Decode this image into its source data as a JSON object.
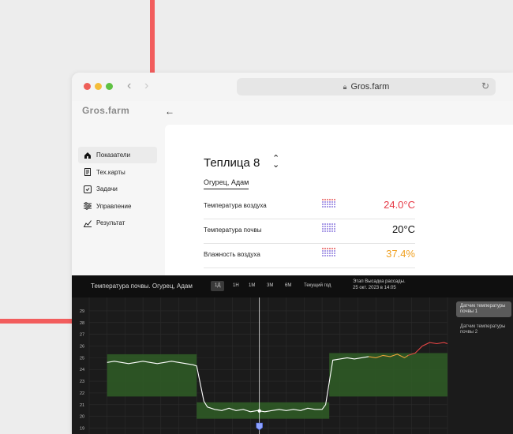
{
  "browser": {
    "url": "Gros.farm"
  },
  "app": {
    "logo": "Gros.farm"
  },
  "sidebar": {
    "items": [
      {
        "label": "Показатели",
        "icon": "home-icon",
        "active": true
      },
      {
        "label": "Тех.карты",
        "icon": "document-icon",
        "active": false
      },
      {
        "label": "Задачи",
        "icon": "task-icon",
        "active": false
      },
      {
        "label": "Управление",
        "icon": "sliders-icon",
        "active": false
      },
      {
        "label": "Результат",
        "icon": "chart-icon",
        "active": false
      }
    ]
  },
  "greenhouse": {
    "title": "Теплица 8",
    "crop": "Огурец, Адам"
  },
  "metrics": [
    {
      "label": "Температура воздуха",
      "value": "24.0°C",
      "color": "#e63946"
    },
    {
      "label": "Температура почвы",
      "value": "20°C",
      "color": "#111111"
    },
    {
      "label": "Влажность воздуха",
      "value": "37.4%",
      "color": "#f0a020"
    }
  ],
  "panel": {
    "title": "Температура почвы. Огурец, Адам",
    "timeframes": [
      "1Д",
      "1Н",
      "1М",
      "3М",
      "6М",
      "Текущий год"
    ],
    "active_timeframe": "1Д",
    "stage_line1": "Этап Высадка рассады.",
    "stage_line2": "25 окт. 2023 в 14:05",
    "sensors": [
      "Датчик температуры почвы 1",
      "Датчик температуры почвы 2"
    ],
    "active_sensor": 0
  },
  "chart_data": {
    "type": "line",
    "y_ticks": [
      29,
      28,
      27,
      26,
      25,
      24,
      23,
      22,
      21,
      20,
      19
    ],
    "ylim": [
      18.5,
      29.6
    ],
    "xlim": [
      0,
      100
    ],
    "grid": true,
    "legend": "right",
    "bands": [
      {
        "x0": 5,
        "x1": 30,
        "y0": 21.7,
        "y1": 25.3,
        "color": "#2f5a26"
      },
      {
        "x0": 30,
        "x1": 67,
        "y0": 19.8,
        "y1": 21.2,
        "color": "#2f5a26"
      },
      {
        "x0": 67,
        "x1": 100,
        "y0": 21.7,
        "y1": 25.4,
        "color": "#2f5a26"
      }
    ],
    "series": [
      {
        "color": "#ffffff",
        "values": [
          [
            5,
            24.6
          ],
          [
            7,
            24.7
          ],
          [
            9,
            24.6
          ],
          [
            11,
            24.5
          ],
          [
            13,
            24.6
          ],
          [
            15,
            24.7
          ],
          [
            17,
            24.6
          ],
          [
            19,
            24.5
          ],
          [
            21,
            24.6
          ],
          [
            23,
            24.7
          ],
          [
            25,
            24.6
          ],
          [
            27,
            24.5
          ],
          [
            29,
            24.4
          ],
          [
            30,
            24.3
          ],
          [
            32,
            21.3
          ],
          [
            33,
            20.8
          ],
          [
            35,
            20.6
          ],
          [
            37,
            20.5
          ],
          [
            39,
            20.7
          ],
          [
            41,
            20.5
          ],
          [
            43,
            20.6
          ],
          [
            45,
            20.4
          ],
          [
            47,
            20.5
          ],
          [
            49,
            20.4
          ],
          [
            51,
            20.5
          ],
          [
            53,
            20.6
          ],
          [
            55,
            20.5
          ],
          [
            57,
            20.6
          ],
          [
            59,
            20.5
          ],
          [
            61,
            20.7
          ],
          [
            63,
            20.6
          ],
          [
            65,
            20.6
          ],
          [
            66,
            21.0
          ],
          [
            68,
            24.8
          ],
          [
            70,
            24.9
          ],
          [
            72,
            25.0
          ],
          [
            74,
            24.9
          ],
          [
            76,
            25.0
          ],
          [
            78,
            25.1
          ]
        ]
      },
      {
        "color": "#e8a03a",
        "values": [
          [
            78,
            25.1
          ],
          [
            80,
            25.0
          ],
          [
            82,
            25.2
          ],
          [
            84,
            25.1
          ],
          [
            86,
            25.3
          ],
          [
            88,
            25.0
          ],
          [
            89,
            25.2
          ]
        ]
      },
      {
        "color": "#e64545",
        "values": [
          [
            89,
            25.2
          ],
          [
            91,
            25.4
          ],
          [
            93,
            26.0
          ],
          [
            95,
            26.3
          ],
          [
            97,
            26.2
          ],
          [
            99,
            26.3
          ],
          [
            100,
            26.2
          ]
        ]
      }
    ],
    "cursor_x": 47.5
  }
}
